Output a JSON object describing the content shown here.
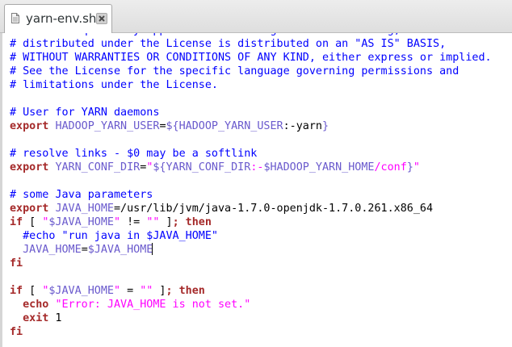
{
  "tab": {
    "title": "yarn-env.sh",
    "icon": "file-icon",
    "close_icon": "close-icon"
  },
  "colors": {
    "comment": "#0000ff",
    "keyword": "#a52a2a",
    "variable": "#6a5acd",
    "string": "#ff00ff"
  },
  "editor": {
    "lines": [
      [
        {
          "t": "comment",
          "s": "# Unless required by applicable law or agreed to in writing, software"
        }
      ],
      [
        {
          "t": "comment",
          "s": "# distributed under the License is distributed on an \"AS IS\" BASIS,"
        }
      ],
      [
        {
          "t": "comment",
          "s": "# WITHOUT WARRANTIES OR CONDITIONS OF ANY KIND, either express or implied."
        }
      ],
      [
        {
          "t": "comment",
          "s": "# See the License for the specific language governing permissions and"
        }
      ],
      [
        {
          "t": "comment",
          "s": "# limitations under the License."
        }
      ],
      [],
      [
        {
          "t": "comment",
          "s": "# User for YARN daemons"
        }
      ],
      [
        {
          "t": "kw",
          "s": "export"
        },
        {
          "t": "plain",
          "s": " "
        },
        {
          "t": "var",
          "s": "HADOOP_YARN_USER"
        },
        {
          "t": "plain",
          "s": "="
        },
        {
          "t": "var",
          "s": "${HADOOP_YARN_USER"
        },
        {
          "t": "plain",
          "s": ":-yarn"
        },
        {
          "t": "var",
          "s": "}"
        }
      ],
      [],
      [
        {
          "t": "comment",
          "s": "# resolve links - $0 may be a softlink"
        }
      ],
      [
        {
          "t": "kw",
          "s": "export"
        },
        {
          "t": "plain",
          "s": " "
        },
        {
          "t": "var",
          "s": "YARN_CONF_DIR"
        },
        {
          "t": "plain",
          "s": "="
        },
        {
          "t": "str",
          "s": "\""
        },
        {
          "t": "var",
          "s": "${YARN_CONF_DIR"
        },
        {
          "t": "str",
          "s": ":-"
        },
        {
          "t": "var",
          "s": "$HADOOP_YARN_HOME"
        },
        {
          "t": "str",
          "s": "/conf"
        },
        {
          "t": "var",
          "s": "}"
        },
        {
          "t": "str",
          "s": "\""
        }
      ],
      [],
      [
        {
          "t": "comment",
          "s": "# some Java parameters"
        }
      ],
      [
        {
          "t": "kw",
          "s": "export"
        },
        {
          "t": "plain",
          "s": " "
        },
        {
          "t": "var",
          "s": "JAVA_HOME"
        },
        {
          "t": "plain",
          "s": "=/usr/lib/jvm/java-1.7.0-openjdk-1.7.0.261.x86_64"
        }
      ],
      [
        {
          "t": "kw",
          "s": "if"
        },
        {
          "t": "plain",
          "s": " [ "
        },
        {
          "t": "str",
          "s": "\""
        },
        {
          "t": "var",
          "s": "$JAVA_HOME"
        },
        {
          "t": "str",
          "s": "\""
        },
        {
          "t": "plain",
          "s": " != "
        },
        {
          "t": "str",
          "s": "\"\""
        },
        {
          "t": "plain",
          "s": " ]"
        },
        {
          "t": "kw",
          "s": "; then"
        }
      ],
      [
        {
          "t": "plain",
          "s": "  "
        },
        {
          "t": "comment",
          "s": "#echo \"run java in $JAVA_HOME\""
        }
      ],
      [
        {
          "t": "plain",
          "s": "  "
        },
        {
          "t": "var",
          "s": "JAVA_HOME"
        },
        {
          "t": "plain",
          "s": "="
        },
        {
          "t": "var",
          "s": "$JAVA_HOME"
        },
        {
          "t": "caret",
          "s": ""
        }
      ],
      [
        {
          "t": "kw",
          "s": "fi"
        }
      ],
      [],
      [
        {
          "t": "kw",
          "s": "if"
        },
        {
          "t": "plain",
          "s": " [ "
        },
        {
          "t": "str",
          "s": "\""
        },
        {
          "t": "var",
          "s": "$JAVA_HOME"
        },
        {
          "t": "str",
          "s": "\""
        },
        {
          "t": "plain",
          "s": " = "
        },
        {
          "t": "str",
          "s": "\"\""
        },
        {
          "t": "plain",
          "s": " ]"
        },
        {
          "t": "kw",
          "s": "; then"
        }
      ],
      [
        {
          "t": "plain",
          "s": "  "
        },
        {
          "t": "kw",
          "s": "echo"
        },
        {
          "t": "plain",
          "s": " "
        },
        {
          "t": "str",
          "s": "\"Error: JAVA_HOME is not set.\""
        }
      ],
      [
        {
          "t": "plain",
          "s": "  "
        },
        {
          "t": "kw",
          "s": "exit"
        },
        {
          "t": "plain",
          "s": " 1"
        }
      ],
      [
        {
          "t": "kw",
          "s": "fi"
        }
      ]
    ]
  }
}
